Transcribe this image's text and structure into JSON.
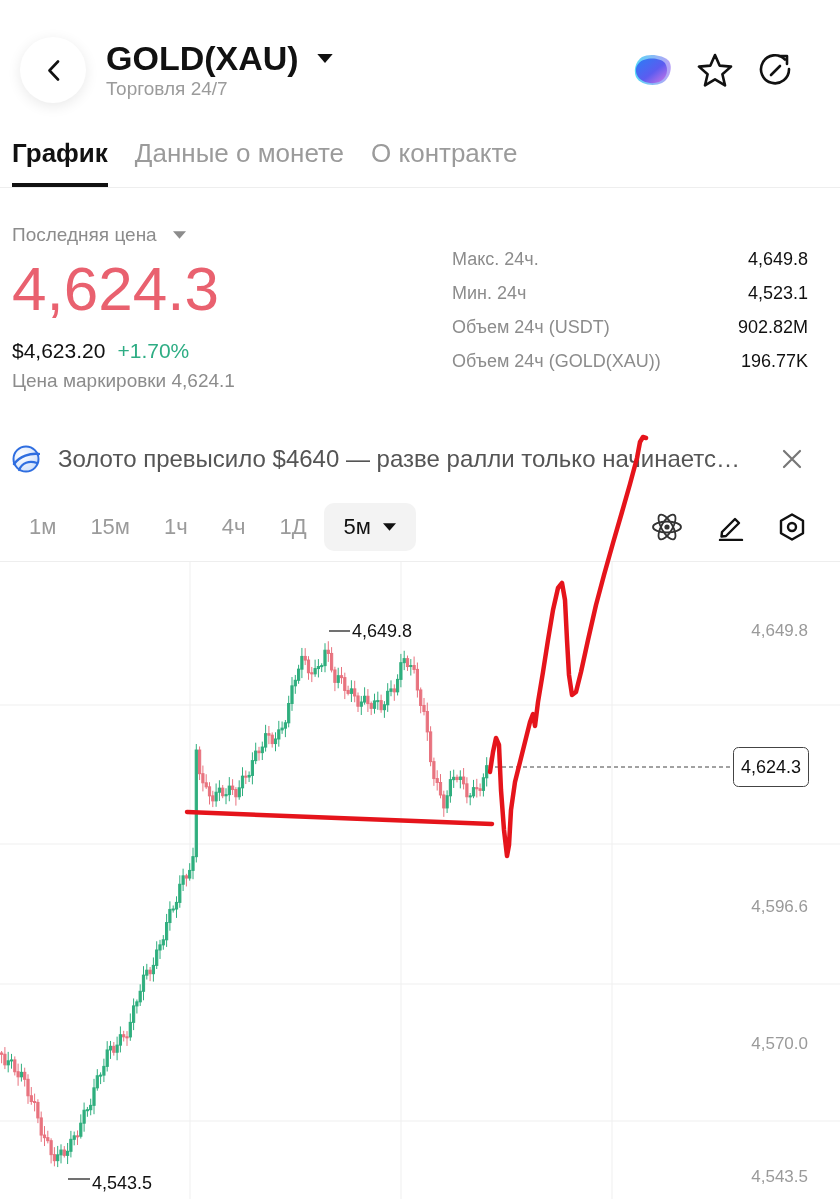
{
  "header": {
    "title": "GOLD(XAU)",
    "subtitle": "Торговля 24/7"
  },
  "tabs": [
    {
      "label": "График",
      "selected": true
    },
    {
      "label": "Данные о монете",
      "selected": false
    },
    {
      "label": "О контракте",
      "selected": false
    }
  ],
  "price": {
    "label": "Последняя цена",
    "last": "4,624.3",
    "usd": "$4,623.20",
    "change": "+1.70%",
    "mark_price": "Цена маркировки 4,624.1"
  },
  "stats": [
    {
      "label": "Макс. 24ч.",
      "value": "4,649.8"
    },
    {
      "label": "Мин. 24ч",
      "value": "4,523.1"
    },
    {
      "label": "Объем 24ч (USDT)",
      "value": "902.82M"
    },
    {
      "label": "Объем 24ч (GOLD(XAU))",
      "value": "196.77K"
    }
  ],
  "news": {
    "text": "Золото превысило $4640 — разве ралли только начинаетс…"
  },
  "intervals": [
    {
      "label": "1м",
      "selected": false
    },
    {
      "label": "15м",
      "selected": false
    },
    {
      "label": "1ч",
      "selected": false
    },
    {
      "label": "4ч",
      "selected": false
    },
    {
      "label": "1Д",
      "selected": false
    },
    {
      "label": "5м",
      "selected": true
    }
  ],
  "chart": {
    "y_axis_labels": [
      "4,649.8",
      "4,596.6",
      "4,570.0",
      "4,543.5"
    ],
    "high_label": "4,649.8",
    "low_label": "4,543.5",
    "current_price": "4,624.3"
  }
}
